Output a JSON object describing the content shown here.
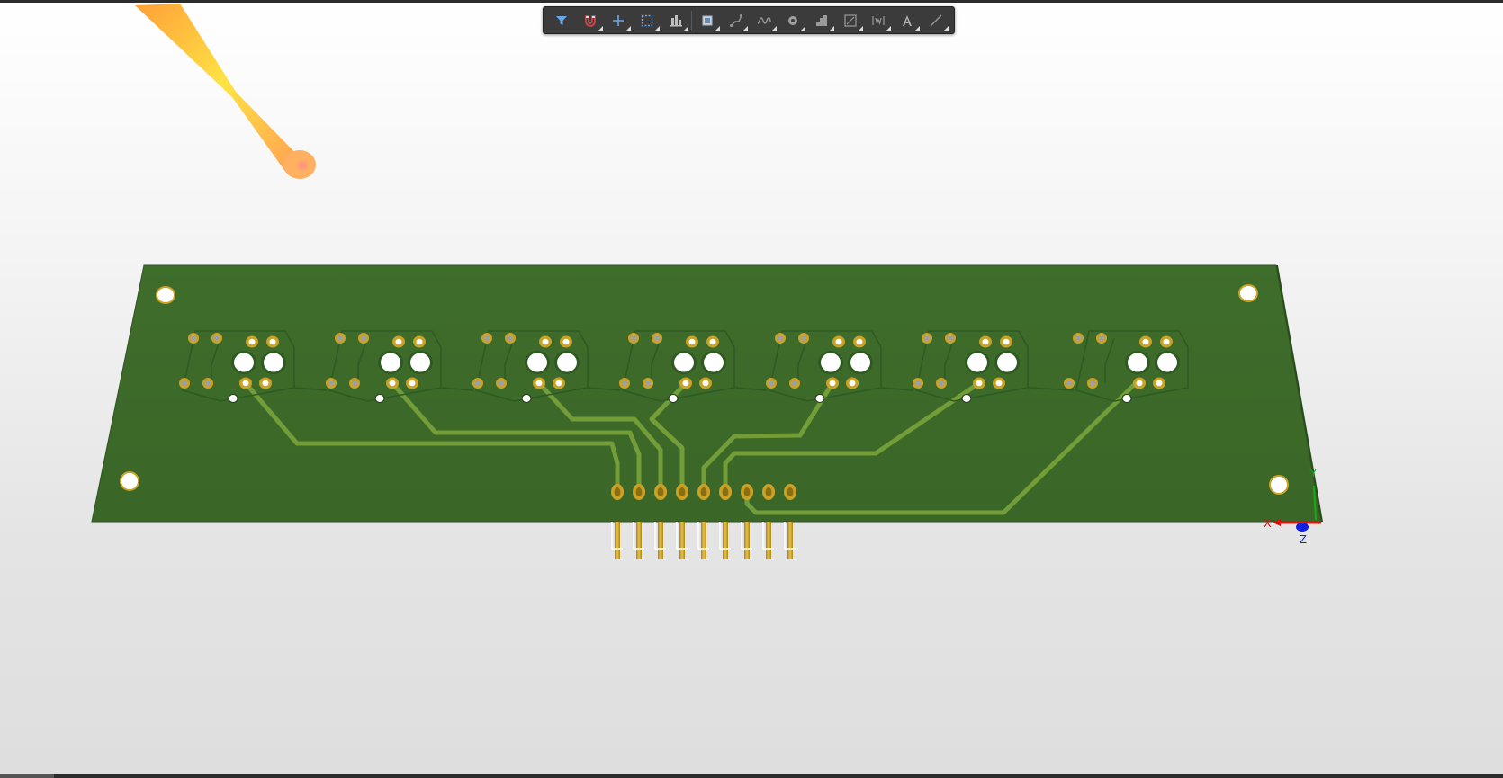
{
  "app": {
    "view": "3D PCB view"
  },
  "toolbar": {
    "items": [
      {
        "name": "filter-icon",
        "has_menu": false
      },
      {
        "name": "snap-magnet-icon",
        "has_menu": true
      },
      {
        "name": "crosshair-add-icon",
        "has_menu": true
      },
      {
        "name": "select-rect-icon",
        "has_menu": true
      },
      {
        "name": "align-icon",
        "has_menu": true
      },
      {
        "name": "place-component-icon",
        "has_menu": true
      },
      {
        "name": "route-track-icon",
        "has_menu": true
      },
      {
        "name": "interactive-length-icon",
        "has_menu": true
      },
      {
        "name": "place-via-icon",
        "has_menu": true
      },
      {
        "name": "polygon-pour-icon",
        "has_menu": true
      },
      {
        "name": "dimension-icon",
        "has_menu": true
      },
      {
        "name": "place-string-icon",
        "has_menu": true
      },
      {
        "name": "text-icon",
        "has_menu": true
      },
      {
        "name": "line-icon",
        "has_menu": true
      }
    ]
  },
  "axes": {
    "x_label": "X",
    "y_label": "Y",
    "z_label": "Z"
  },
  "colors": {
    "board": "#3d6b2a",
    "board_edge": "#2f5520",
    "track": "#6f9a35",
    "pad": "#c9a227",
    "x_axis": "#e01010",
    "y_axis": "#10b010",
    "z_axis": "#1020e0"
  },
  "board": {
    "component_groups": 7,
    "header_pins": 9
  }
}
